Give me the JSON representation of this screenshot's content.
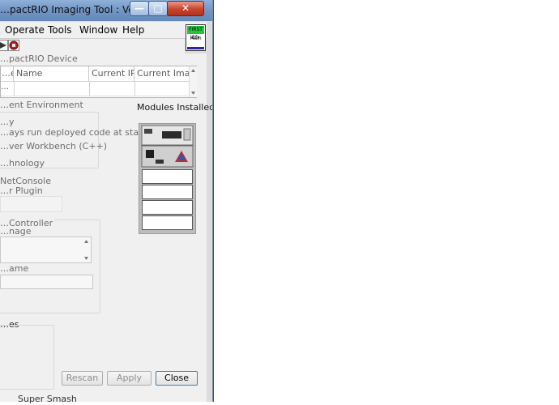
{
  "window": {
    "title": "…pactRIO Imaging Tool : Version …"
  },
  "menu": {
    "items": [
      "Operate",
      "Tools",
      "Window",
      "Help"
    ]
  },
  "logo": {
    "top_text": "FIRST Gfx",
    "label": "Main"
  },
  "device_section": {
    "label": "…pactRIO Device",
    "columns": [
      "…ess",
      "Name",
      "Current IP",
      "Current Imag…"
    ],
    "rows": [
      [
        "…",
        "",
        "",
        ""
      ]
    ]
  },
  "environment": {
    "label": "…ent Environment",
    "lines": [
      "…y",
      "…ays run deployed code at startup",
      "…ver Workbench (C++)",
      "…hnology"
    ]
  },
  "plugins": {
    "lines": [
      "NetConsole",
      "…r Plugin"
    ]
  },
  "modules": {
    "label": "Modules Installed"
  },
  "controller": {
    "label": "…Controller",
    "image_label": "…nage",
    "name_label": "…ame"
  },
  "extra": {
    "label": "…es"
  },
  "buttons": {
    "rescan": "Rescan",
    "apply": "Apply",
    "close": "Close"
  },
  "taskbar": {
    "text": "Super Smash"
  },
  "colors": {
    "title_gradient_top": "#8fb0d9",
    "close_red": "#c8442c",
    "logo_green": "#24c43a"
  }
}
